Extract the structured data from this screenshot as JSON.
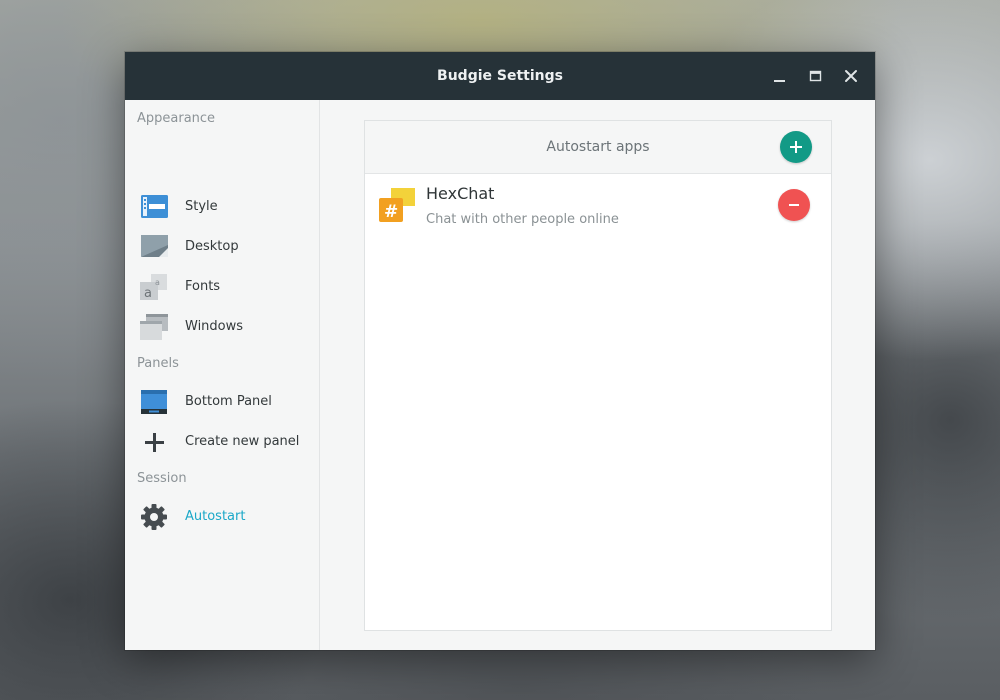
{
  "window": {
    "title": "Budgie Settings"
  },
  "sidebar": {
    "sections": [
      {
        "label": "Appearance"
      },
      {
        "label": "Panels"
      },
      {
        "label": "Session"
      }
    ],
    "items": [
      {
        "label": "Style",
        "icon": "style-icon"
      },
      {
        "label": "Desktop",
        "icon": "desktop-icon"
      },
      {
        "label": "Fonts",
        "icon": "fonts-icon"
      },
      {
        "label": "Windows",
        "icon": "windows-icon"
      },
      {
        "label": "Bottom Panel",
        "icon": "panel-icon"
      },
      {
        "label": "Create new panel",
        "icon": "plus-icon"
      },
      {
        "label": "Autostart",
        "icon": "gear-icon",
        "active": true
      }
    ]
  },
  "autostart": {
    "header": "Autostart apps",
    "apps": [
      {
        "name": "HexChat",
        "description": "Chat with other people online",
        "icon": "hexchat-icon"
      }
    ]
  },
  "colors": {
    "titlebar": "#263238",
    "accent": "#1ba8c8",
    "add_button": "#129a86",
    "remove_button": "#f05252"
  }
}
